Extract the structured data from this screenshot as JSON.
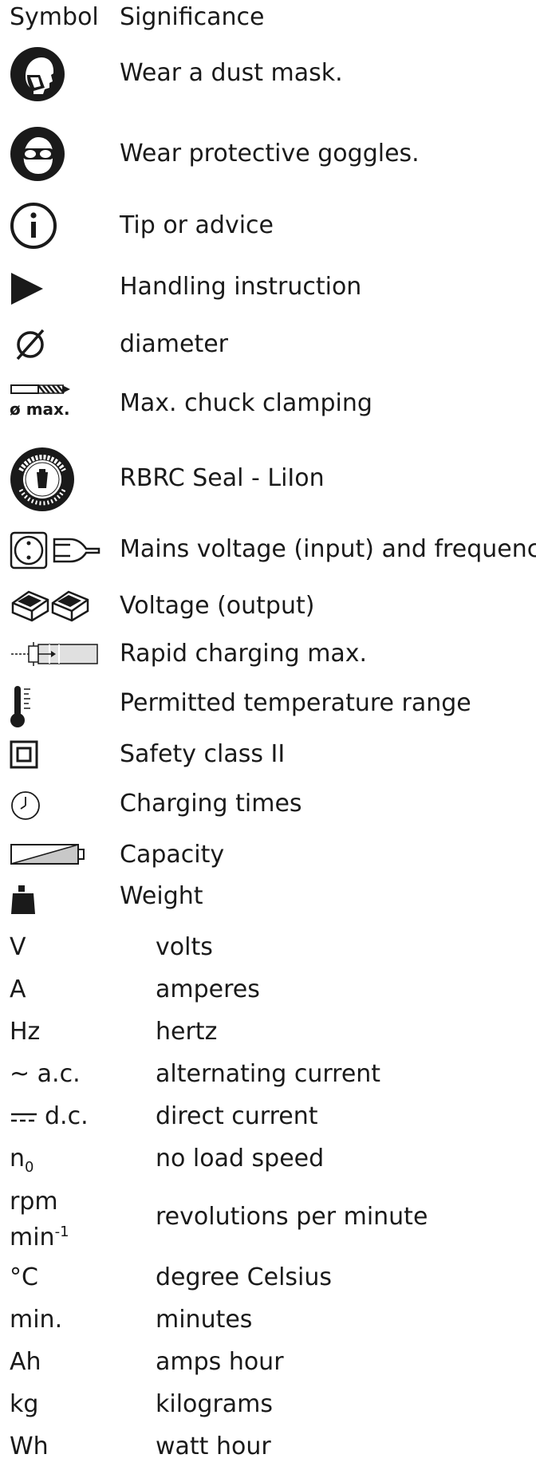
{
  "header": {
    "symbol": "Symbol",
    "significance": "Significance"
  },
  "symbols": [
    {
      "icon": "dust-mask-icon",
      "text": "Wear a dust mask."
    },
    {
      "icon": "goggles-icon",
      "text": "Wear protective goggles."
    },
    {
      "icon": "info-icon",
      "text": "Tip or advice"
    },
    {
      "icon": "play-triangle-icon",
      "text": "Handling instruction"
    },
    {
      "icon": "diameter-icon",
      "text": "diameter"
    },
    {
      "icon": "chuck-clamping-icon",
      "icon_label": "ø max.",
      "text": "Max. chuck clamping"
    },
    {
      "icon": "rbrc-seal-icon",
      "text": "RBRC Seal - LiIon"
    },
    {
      "icon": "mains-plug-icon",
      "text": "Mains voltage (input) and frequency"
    },
    {
      "icon": "battery-packs-icon",
      "text": "Voltage (output)"
    },
    {
      "icon": "rapid-charging-icon",
      "text": "Rapid charging max."
    },
    {
      "icon": "thermometer-icon",
      "text": "Permitted temperature range"
    },
    {
      "icon": "safety-class-ii-icon",
      "text": "Safety class II"
    },
    {
      "icon": "clock-icon",
      "text": "Charging times"
    },
    {
      "icon": "battery-capacity-icon",
      "text": "Capacity"
    },
    {
      "icon": "weight-icon",
      "text": "Weight"
    }
  ],
  "units": [
    {
      "abbr": "V",
      "text": "volts"
    },
    {
      "abbr": "A",
      "text": "amperes"
    },
    {
      "abbr": "Hz",
      "text": "hertz"
    },
    {
      "abbr": "~ a.c.",
      "text": "alternating current"
    },
    {
      "abbr": "d.c.",
      "text": "direct current"
    },
    {
      "abbr": "n",
      "abbr_sub": "0",
      "text": "no load speed"
    },
    {
      "abbr": "rpm",
      "abbr2": "min",
      "abbr2_sup": "-1",
      "text": "revolutions per minute"
    },
    {
      "abbr": "°C",
      "text": "degree Celsius"
    },
    {
      "abbr": "min.",
      "text": "minutes"
    },
    {
      "abbr": "Ah",
      "text": "amps hour"
    },
    {
      "abbr": "kg",
      "text": "kilograms"
    },
    {
      "abbr": "Wh",
      "text": "watt hour"
    }
  ]
}
